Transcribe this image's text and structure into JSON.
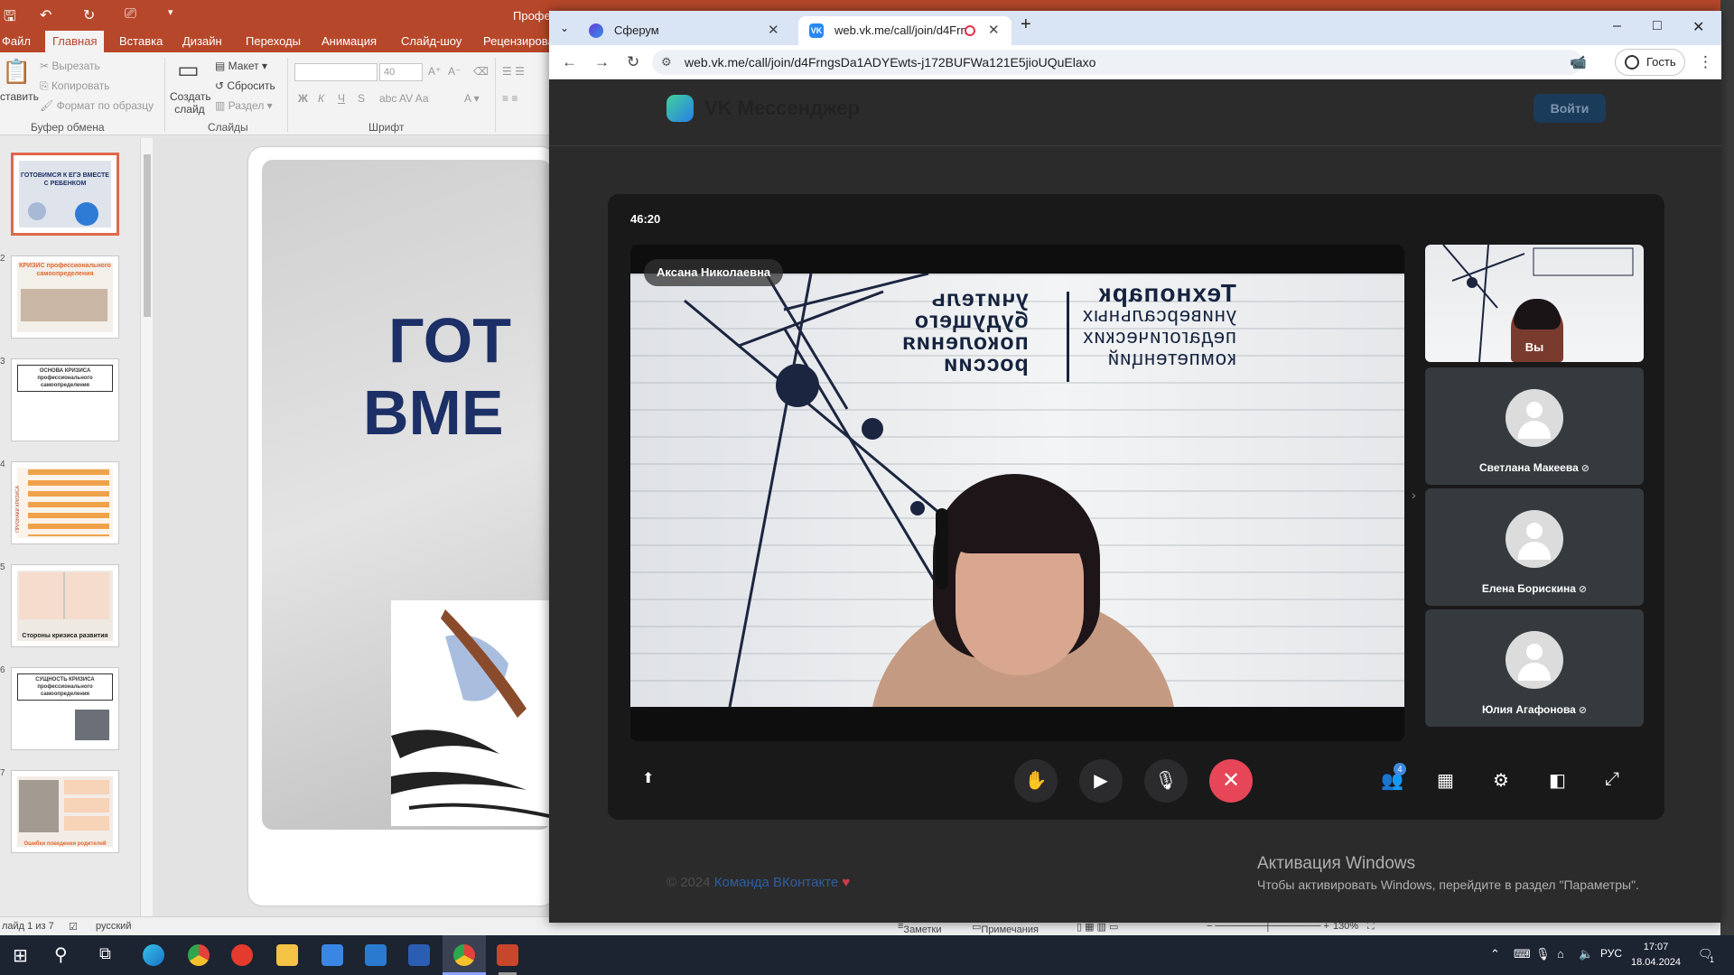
{
  "powerpoint": {
    "title_fragment": "Профе",
    "tabs": [
      "Файл",
      "Главная",
      "Вставка",
      "Дизайн",
      "Переходы",
      "Анимация",
      "Слайд-шоу",
      "Рецензирова"
    ],
    "ribbon": {
      "paste": "ставить",
      "cut": "Вырезать",
      "copy": "Копировать",
      "format_painter": "Формат по образцу",
      "clipboard_group": "Буфер обмена",
      "new_slide": "Создать слайд",
      "layout": "Макет",
      "reset": "Сбросить",
      "section": "Раздел",
      "slides_group": "Слайды",
      "font_size": "40",
      "font_group": "Шрифт",
      "bold": "Ж",
      "italic": "К",
      "underline": "Ч",
      "strike": "S"
    },
    "thumbnails": [
      {
        "num": "",
        "text": "ГОТОВИМСЯ К ЕГЭ ВМЕСТЕ С РЕБЕНКОМ"
      },
      {
        "num": "2",
        "text": "КРИЗИС профессионального самоопределения"
      },
      {
        "num": "3",
        "text": "ОСНОВА КРИЗИСА профессионального самоопределения"
      },
      {
        "num": "4",
        "text": "ПРИЗНАКИ КРИЗИСА"
      },
      {
        "num": "5",
        "text": "Стороны кризиса развития"
      },
      {
        "num": "6",
        "text": "СУЩНОСТЬ КРИЗИСА профессионального самоопределения"
      },
      {
        "num": "7",
        "text": "Ошибки поведения родителей"
      }
    ],
    "slide_title_line1": "ГОТ",
    "slide_title_line2": "ВМЕ",
    "status": {
      "slide_info": "лайд 1 из 7",
      "language": "русский",
      "notes": "Заметки",
      "comments": "Примечания",
      "zoom": "130%"
    }
  },
  "browser": {
    "tabs": [
      {
        "label": "Сферум",
        "active": false
      },
      {
        "label": "web.vk.me/call/join/d4Frn",
        "active": true
      }
    ],
    "new_tab": "+",
    "url": "web.vk.me/call/join/d4FrngsDa1ADYEwts-j172BUFWa121E5jioUQuElaxo",
    "guest": "Гость",
    "controls": {
      "minimize": "–",
      "maximize": "□",
      "close": "✕"
    }
  },
  "vk": {
    "brand": "VK Мессенджер",
    "login": "Войти",
    "footer_copy": "© 2024 ",
    "footer_link": "Команда ВКонтакте",
    "heart": "♥"
  },
  "call": {
    "timer": "46:20",
    "speaker": "Аксана Николаевна",
    "poster_left": [
      "учитель",
      "будущего",
      "поколения",
      "россии"
    ],
    "poster_right": [
      "Технопарк",
      "универсальных",
      "педагогических",
      "компетенций"
    ],
    "participants": [
      {
        "name": "Вы",
        "self": true
      },
      {
        "name": "Светлана Макеева",
        "muted": true
      },
      {
        "name": "Елена Борискина",
        "muted": true
      },
      {
        "name": "Юлия Агафонова",
        "muted": true
      }
    ],
    "participants_badge": "4",
    "mic_off_glyph": "🎙̸"
  },
  "windows": {
    "activation_title": "Активация Windows",
    "activation_text": "Чтобы активировать Windows, перейдите в раздел \"Параметры\".",
    "lang": "РУС",
    "time": "17:07",
    "date": "18.04.2024",
    "notify_count": "1"
  },
  "colors": {
    "ppt_accent": "#b7472a",
    "vk_end_call": "#e64657",
    "taskbar": "#1c2331"
  }
}
